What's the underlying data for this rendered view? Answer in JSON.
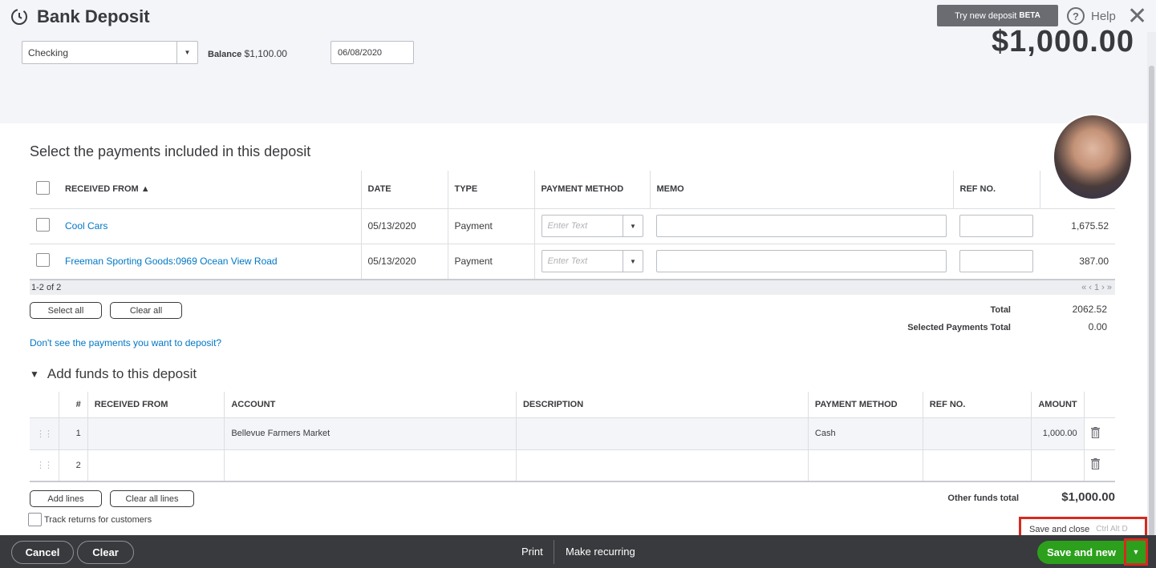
{
  "header": {
    "title": "Bank Deposit",
    "beta_button": "Try new deposit",
    "beta_tag": "BETA",
    "help_label": "Help",
    "account": "Checking",
    "balance_label": "Balance",
    "balance_value": "$1,100.00",
    "date": "06/08/2020",
    "amount": "$1,000.00"
  },
  "payments": {
    "title": "Select the payments included in this deposit",
    "columns": [
      "RECEIVED FROM ▲",
      "DATE",
      "TYPE",
      "PAYMENT METHOD",
      "MEMO",
      "REF NO."
    ],
    "rows": [
      {
        "received_from": "Cool Cars",
        "date": "05/13/2020",
        "type": "Payment",
        "method_placeholder": "Enter Text",
        "amount": "1,675.52"
      },
      {
        "received_from": "Freeman Sporting Goods:0969 Ocean View Road",
        "date": "05/13/2020",
        "type": "Payment",
        "method_placeholder": "Enter Text",
        "amount": "387.00"
      }
    ],
    "pager_text": "1-2 of 2",
    "pager_nav": "« ‹ 1 › »",
    "select_all": "Select all",
    "clear_all": "Clear all",
    "total_label": "Total",
    "total_value": "2062.52",
    "selected_label": "Selected Payments Total",
    "selected_value": "0.00",
    "dont_see_link": "Don't see the payments you want to deposit?"
  },
  "funds": {
    "title": "Add funds to this deposit",
    "columns": [
      "#",
      "RECEIVED FROM",
      "ACCOUNT",
      "DESCRIPTION",
      "PAYMENT METHOD",
      "REF NO.",
      "AMOUNT"
    ],
    "rows": [
      {
        "num": "1",
        "received_from": "",
        "account": "Bellevue Farmers Market",
        "description": "",
        "method": "Cash",
        "ref": "",
        "amount": "1,000.00"
      },
      {
        "num": "2",
        "received_from": "",
        "account": "",
        "description": "",
        "method": "",
        "ref": "",
        "amount": ""
      }
    ],
    "add_lines": "Add lines",
    "clear_all_lines": "Clear all lines",
    "track_returns": "Track returns for customers",
    "other_total_label": "Other funds total",
    "other_total_value": "$1,000.00"
  },
  "save_popup": {
    "label": "Save and close",
    "shortcut": "Ctrl Alt D"
  },
  "footer": {
    "cancel": "Cancel",
    "clear": "Clear",
    "print": "Print",
    "make_recurring": "Make recurring",
    "save_new": "Save and new"
  }
}
